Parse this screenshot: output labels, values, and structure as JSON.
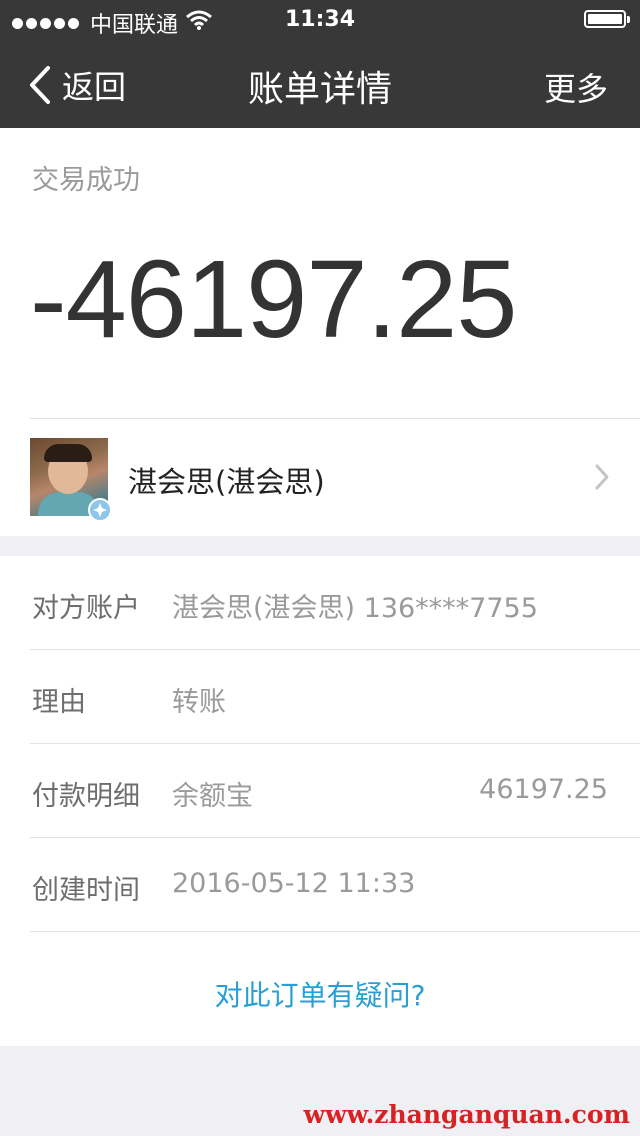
{
  "status_bar": {
    "carrier": "中国联通",
    "time": "11:34"
  },
  "nav": {
    "back_label": "返回",
    "title": "账单详情",
    "more_label": "更多"
  },
  "transaction": {
    "status": "交易成功",
    "amount": "-46197.25",
    "counterparty_name": "湛会思(湛会思)"
  },
  "details": [
    {
      "label": "对方账户",
      "value": "湛会思(湛会思) 136****7755",
      "amount": ""
    },
    {
      "label": "理由",
      "value": "转账",
      "amount": ""
    },
    {
      "label": "付款明细",
      "value": "余额宝",
      "amount": "46197.25"
    },
    {
      "label": "创建时间",
      "value": "2016-05-12 11:33",
      "amount": ""
    }
  ],
  "question_link": "对此订单有疑问?",
  "watermark": "www.zhanganquan.com",
  "colors": {
    "nav_background": "#383838",
    "link": "#2a9fd6",
    "watermark": "#d62222"
  }
}
